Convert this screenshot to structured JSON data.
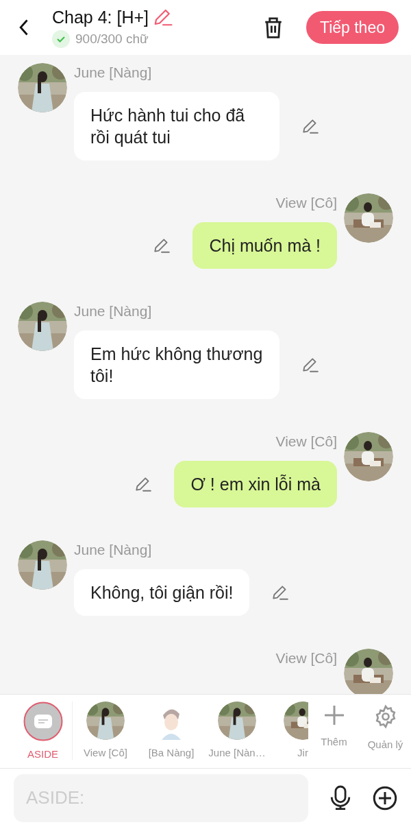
{
  "header": {
    "title": "Chap 4: [H+]",
    "word_count": "900/300 chữ",
    "count_ok": true,
    "next_button": "Tiếp theo"
  },
  "messages": [
    {
      "outgoing": false,
      "sender": "June [Nàng]",
      "text": "Hức hành tui cho đã rồi quát tui"
    },
    {
      "outgoing": true,
      "sender": "View [Cô]",
      "text": "Chị muốn mà !"
    },
    {
      "outgoing": false,
      "sender": "June [Nàng]",
      "text": "Em hức không thương tôi!"
    },
    {
      "outgoing": true,
      "sender": "View [Cô]",
      "text": "Ơ ! em xin lỗi mà"
    },
    {
      "outgoing": false,
      "sender": "June [Nàng]",
      "text": "Không, tôi giận rồi!"
    },
    {
      "outgoing": true,
      "sender": "View [Cô]"
    }
  ],
  "characters": [
    {
      "kind": "aside",
      "label": "ASIDE",
      "selected": true
    },
    {
      "label": "View [Cô]",
      "selected": false
    },
    {
      "kind": "drawn",
      "label": "[Ba Nàng]",
      "selected": false
    },
    {
      "label": "June [Nàn…",
      "selected": false
    },
    {
      "label": "Jir",
      "selected": false
    }
  ],
  "actions": [
    {
      "kind": "add",
      "label": "Thêm"
    },
    {
      "kind": "manage",
      "label": "Quản lý"
    }
  ],
  "input": {
    "placeholder": "ASIDE:"
  }
}
